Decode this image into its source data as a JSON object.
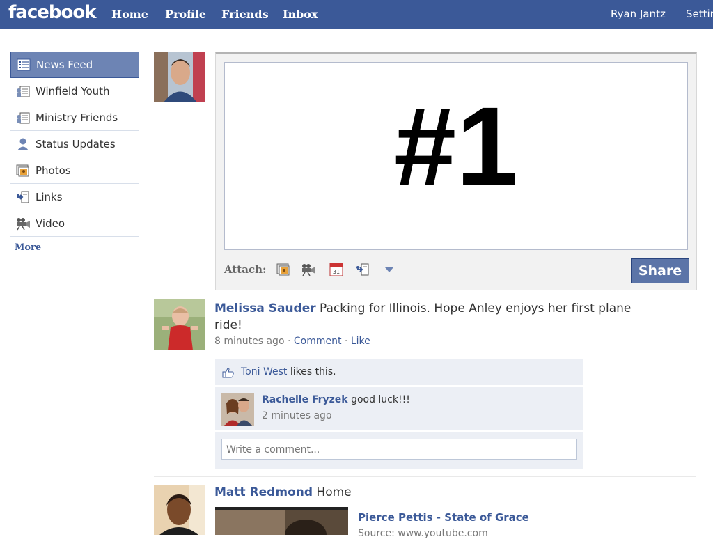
{
  "header": {
    "logo": "facebook",
    "nav": [
      "Home",
      "Profile",
      "Friends",
      "Inbox"
    ],
    "user_name": "Ryan Jantz",
    "settings": "Settin"
  },
  "sidebar": {
    "items": [
      {
        "label": "News Feed",
        "icon": "news-feed-icon"
      },
      {
        "label": "Winfield Youth",
        "icon": "group-list-icon"
      },
      {
        "label": "Ministry Friends",
        "icon": "group-list-icon"
      },
      {
        "label": "Status Updates",
        "icon": "person-icon"
      },
      {
        "label": "Photos",
        "icon": "photo-icon"
      },
      {
        "label": "Links",
        "icon": "link-icon"
      },
      {
        "label": "Video",
        "icon": "video-camera-icon"
      }
    ],
    "more": "More"
  },
  "composer": {
    "text": "#1",
    "attach_label": "Attach:",
    "share_label": "Share"
  },
  "posts": [
    {
      "author": "Melissa Sauder",
      "text": "Packing for Illinois. Hope Anley enjoys her first plane ride!",
      "time": "8 minutes ago",
      "comment": "Comment",
      "like": "Like",
      "likes_name": "Toni West",
      "likes_text": "likes this.",
      "comments": [
        {
          "author": "Rachelle Fryzek",
          "text": "good luck!!!",
          "time": "2 minutes ago"
        }
      ],
      "comment_placeholder": "Write a comment..."
    },
    {
      "author": "Matt Redmond",
      "text": "Home",
      "link_title": "Pierce Pettis - State of Grace",
      "link_source": "Source: www.youtube.com"
    }
  ]
}
